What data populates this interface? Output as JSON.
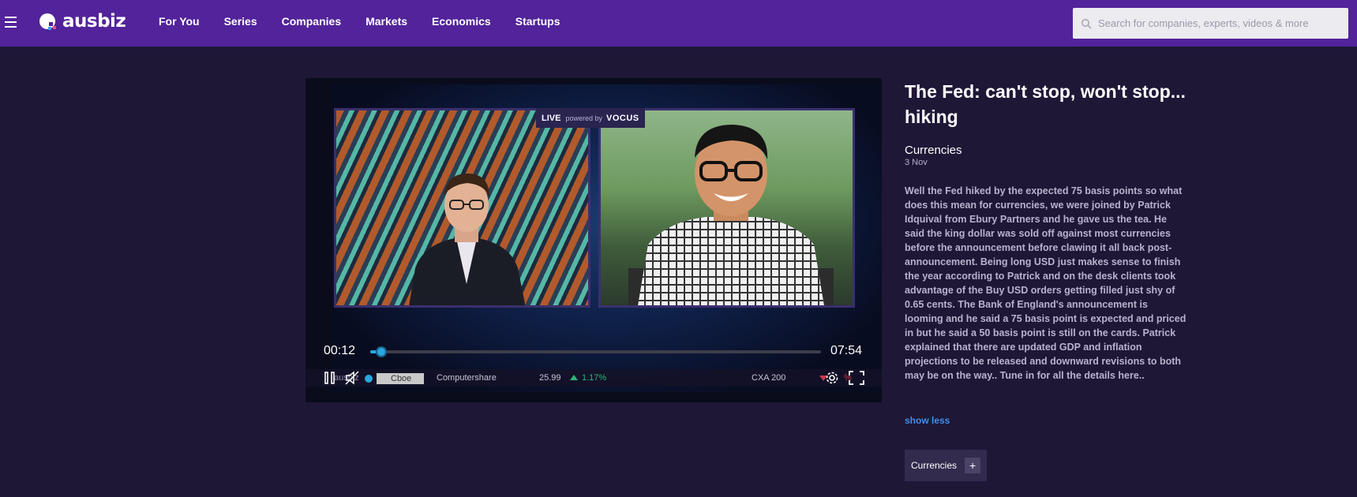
{
  "nav": {
    "logo_text": "ausbiz",
    "links": [
      "For You",
      "Series",
      "Companies",
      "Markets",
      "Economics",
      "Startups"
    ],
    "search_placeholder": "Search for companies, experts, videos & more"
  },
  "player": {
    "live_label": "LIVE",
    "powered_by": "powered by",
    "brand": "VOCUS",
    "current_time": "00:12",
    "duration": "07:54",
    "progress_fraction": 0.025,
    "ticker": {
      "left_text": "ausbiz",
      "cboe": "Cboe",
      "company": "Computershare",
      "price": "25.99",
      "change": "1.17%",
      "index": "CXA 200",
      "index_change": "%"
    }
  },
  "video": {
    "title": "The Fed: can't stop, won't stop... hiking",
    "category": "Currencies",
    "date": "3 Nov",
    "description": "Well the Fed hiked by the expected 75 basis points so what does this mean for currencies, we were joined by Patrick Idquival from Ebury Partners and he gave us the tea. He said the king dollar was sold off against most currencies before the announcement before clawing it all back post-announcement. Being long USD just makes sense to finish the year according to Patrick and on the desk clients took advantage of the Buy USD orders getting filled just shy of 0.65 cents. The Bank of England's announcement is looming and he said a 75 basis point is expected and priced in but he said a 50 basis point is still on the cards. Patrick explained that there are updated GDP and inflation projections to be released and downward revisions to both may be on the way.. Tune in for all the details here..",
    "show_less": "show less",
    "tag": "Currencies",
    "tag_plus": "+"
  },
  "colors": {
    "nav_bg": "#52239a",
    "page_bg": "#1f1736",
    "accent_blue": "#2aa6e0",
    "link_blue": "#3b8ff0",
    "up_green": "#2bb673",
    "down_red": "#d0364a"
  }
}
